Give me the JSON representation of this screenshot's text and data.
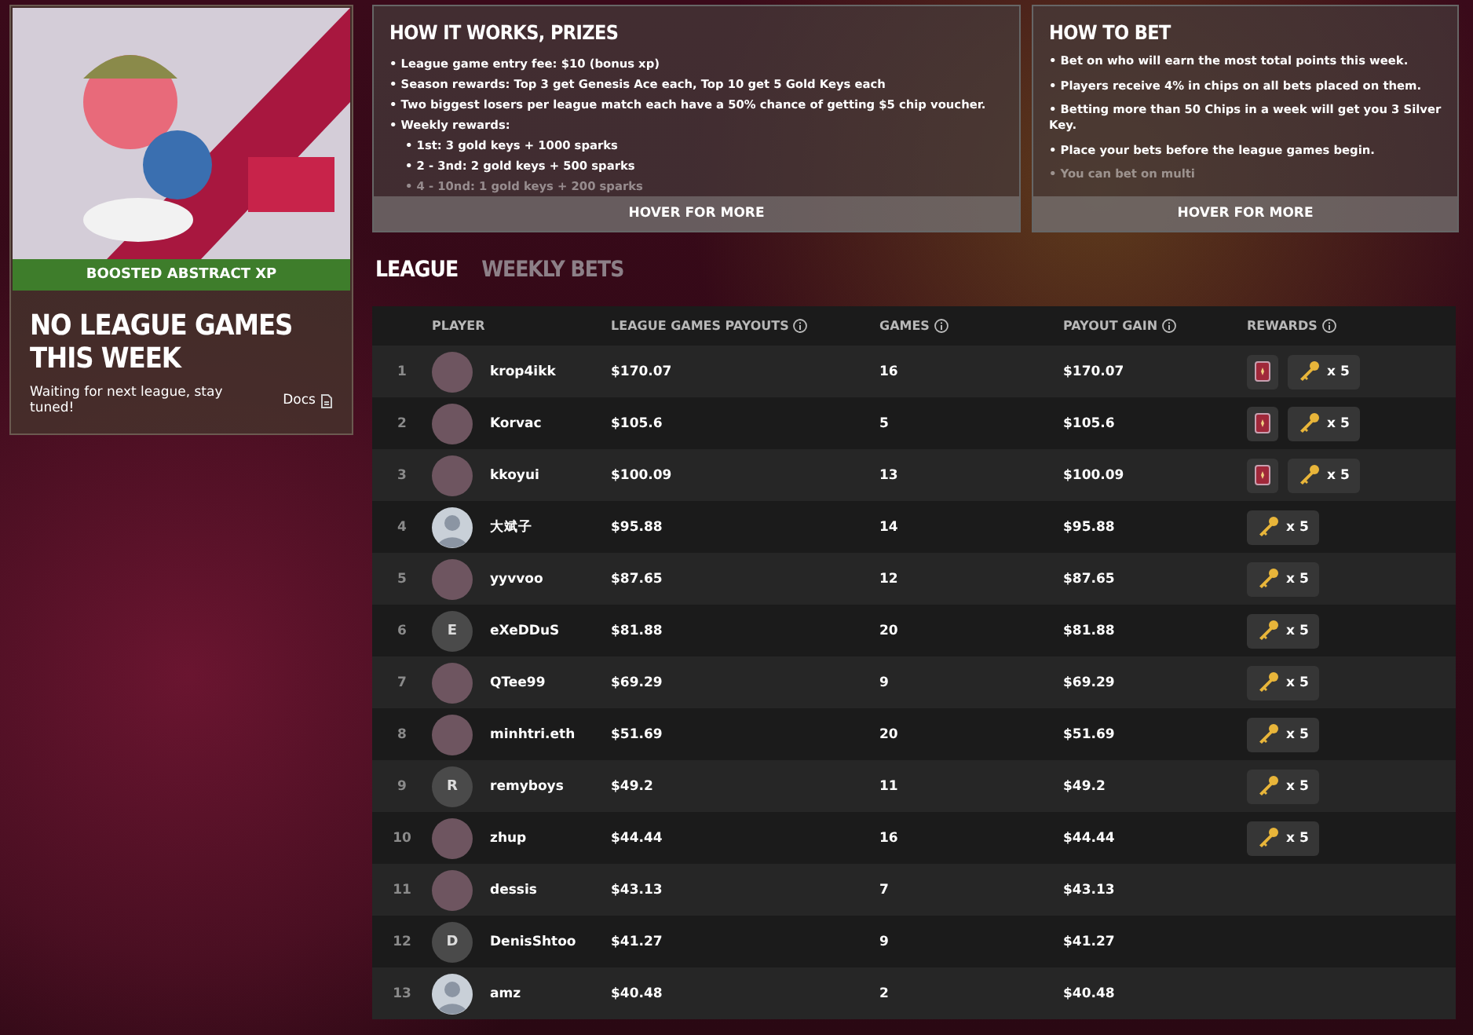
{
  "promo_card": {
    "banner_label": "BOOSTED ABSTRACT XP",
    "title": "NO LEAGUE GAMES THIS WEEK",
    "message": "Waiting for next league, stay tuned!",
    "docs_link": "Docs"
  },
  "panels": [
    {
      "title": "HOW IT WORKS, PRIZES",
      "items": [
        {
          "text": "• League game entry fee: $10 (bonus xp)"
        },
        {
          "text": "• Season rewards: Top 3 get Genesis Ace each, Top 10 get 5 Gold Keys each"
        },
        {
          "text": "• Two biggest losers per league match each have a 50% chance of getting $5 chip voucher."
        },
        {
          "text": "• Weekly rewards:",
          "children": [
            {
              "text": "• 1st:  3 gold keys + 1000 sparks"
            },
            {
              "text": "• 2 - 3nd: 2 gold keys + 500 sparks"
            },
            {
              "text": "• 4 - 10nd: 1 gold keys + 200 sparks"
            }
          ]
        }
      ],
      "more": "HOVER FOR MORE"
    },
    {
      "title": "HOW TO BET",
      "items": [
        {
          "text": "• Bet on who will earn the most total points this week."
        },
        {
          "text": "• Players receive 4% in chips on all bets placed on them."
        },
        {
          "text": "• Betting more than 50 Chips in a week will get you 3 Silver Key."
        },
        {
          "text": "• Place your bets before the league games begin."
        },
        {
          "text": "• You can bet on multi"
        }
      ],
      "more": "HOVER FOR MORE"
    }
  ],
  "tabs": [
    {
      "label": "LEAGUE",
      "selected": true
    },
    {
      "label": "WEEKLY BETS",
      "selected": false
    }
  ],
  "table": {
    "columns": [
      "PLAYER",
      "LEAGUE GAMES PAYOUTS",
      "GAMES",
      "PAYOUT GAIN",
      "REWARDS"
    ],
    "rows": [
      {
        "rank": "1",
        "avatar": {
          "kind": "photo"
        },
        "player": "krop4ikk",
        "payouts": "$170.07",
        "games": "16",
        "gain": "$170.07",
        "card_reward": true,
        "keys": "x 5"
      },
      {
        "rank": "2",
        "avatar": {
          "kind": "photo"
        },
        "player": "Korvac",
        "payouts": "$105.6",
        "games": "5",
        "gain": "$105.6",
        "card_reward": true,
        "keys": "x 5"
      },
      {
        "rank": "3",
        "avatar": {
          "kind": "photo"
        },
        "player": "kkoyui",
        "payouts": "$100.09",
        "games": "13",
        "gain": "$100.09",
        "card_reward": true,
        "keys": "x 5"
      },
      {
        "rank": "4",
        "avatar": {
          "kind": "default"
        },
        "player": "大斌子",
        "payouts": "$95.88",
        "games": "14",
        "gain": "$95.88",
        "card_reward": false,
        "keys": "x 5"
      },
      {
        "rank": "5",
        "avatar": {
          "kind": "photo"
        },
        "player": "yyvvoo",
        "payouts": "$87.65",
        "games": "12",
        "gain": "$87.65",
        "card_reward": false,
        "keys": "x 5"
      },
      {
        "rank": "6",
        "avatar": {
          "kind": "letter",
          "initial": "E"
        },
        "player": "eXeDDuS",
        "payouts": "$81.88",
        "games": "20",
        "gain": "$81.88",
        "card_reward": false,
        "keys": "x 5"
      },
      {
        "rank": "7",
        "avatar": {
          "kind": "photo"
        },
        "player": "QTee99",
        "payouts": "$69.29",
        "games": "9",
        "gain": "$69.29",
        "card_reward": false,
        "keys": "x 5"
      },
      {
        "rank": "8",
        "avatar": {
          "kind": "photo"
        },
        "player": "minhtri.eth",
        "payouts": "$51.69",
        "games": "20",
        "gain": "$51.69",
        "card_reward": false,
        "keys": "x 5"
      },
      {
        "rank": "9",
        "avatar": {
          "kind": "letter",
          "initial": "R"
        },
        "player": "remyboys",
        "payouts": "$49.2",
        "games": "11",
        "gain": "$49.2",
        "card_reward": false,
        "keys": "x 5"
      },
      {
        "rank": "10",
        "avatar": {
          "kind": "photo"
        },
        "player": "zhup",
        "payouts": "$44.44",
        "games": "16",
        "gain": "$44.44",
        "card_reward": false,
        "keys": "x 5"
      },
      {
        "rank": "11",
        "avatar": {
          "kind": "photo"
        },
        "player": "dessis",
        "payouts": "$43.13",
        "games": "7",
        "gain": "$43.13",
        "card_reward": false
      },
      {
        "rank": "12",
        "avatar": {
          "kind": "letter",
          "initial": "D"
        },
        "player": "DenisShtoo",
        "payouts": "$41.27",
        "games": "9",
        "gain": "$41.27",
        "card_reward": false
      },
      {
        "rank": "13",
        "avatar": {
          "kind": "default"
        },
        "player": "amz",
        "payouts": "$40.48",
        "games": "2",
        "gain": "$40.48",
        "card_reward": false
      }
    ]
  }
}
